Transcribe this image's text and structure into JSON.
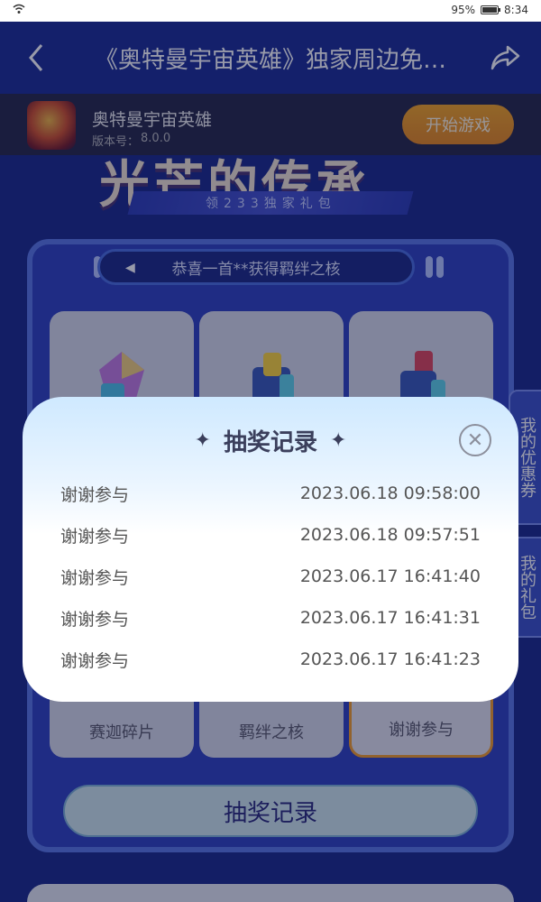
{
  "status_bar": {
    "battery": "95%",
    "time": "8:34"
  },
  "nav": {
    "title": "《奥特曼宇宙英雄》独家周边免…",
    "back_icon": "chevron-left-icon",
    "share_icon": "share-icon"
  },
  "game": {
    "name": "奥特曼宇宙英雄",
    "version_label": "版本号：",
    "version": "8.0.0",
    "start_label": "开始游戏"
  },
  "hero": {
    "title": "光芒的传承",
    "subtitle": "领233独家礼包"
  },
  "ticker": {
    "text": "恭喜一首**获得羁绊之核"
  },
  "prizes": [
    {
      "label": "赛迦碎片"
    },
    {
      "label": "羁绊之核"
    },
    {
      "label": "谢谢参与"
    }
  ],
  "record_button": {
    "label": "抽奖记录"
  },
  "side_tabs": [
    {
      "label": "我的优惠券"
    },
    {
      "label": "我的礼包"
    }
  ],
  "modal": {
    "title": "抽奖记录",
    "records": [
      {
        "result": "谢谢参与",
        "time": "2023.06.18 09:58:00"
      },
      {
        "result": "谢谢参与",
        "time": "2023.06.18 09:57:51"
      },
      {
        "result": "谢谢参与",
        "time": "2023.06.17 16:41:40"
      },
      {
        "result": "谢谢参与",
        "time": "2023.06.17 16:41:31"
      },
      {
        "result": "谢谢参与",
        "time": "2023.06.17 16:41:23"
      }
    ]
  },
  "colors": {
    "nav": "#1c2e94",
    "accent": "#f5a623",
    "board": "#3042c0"
  }
}
